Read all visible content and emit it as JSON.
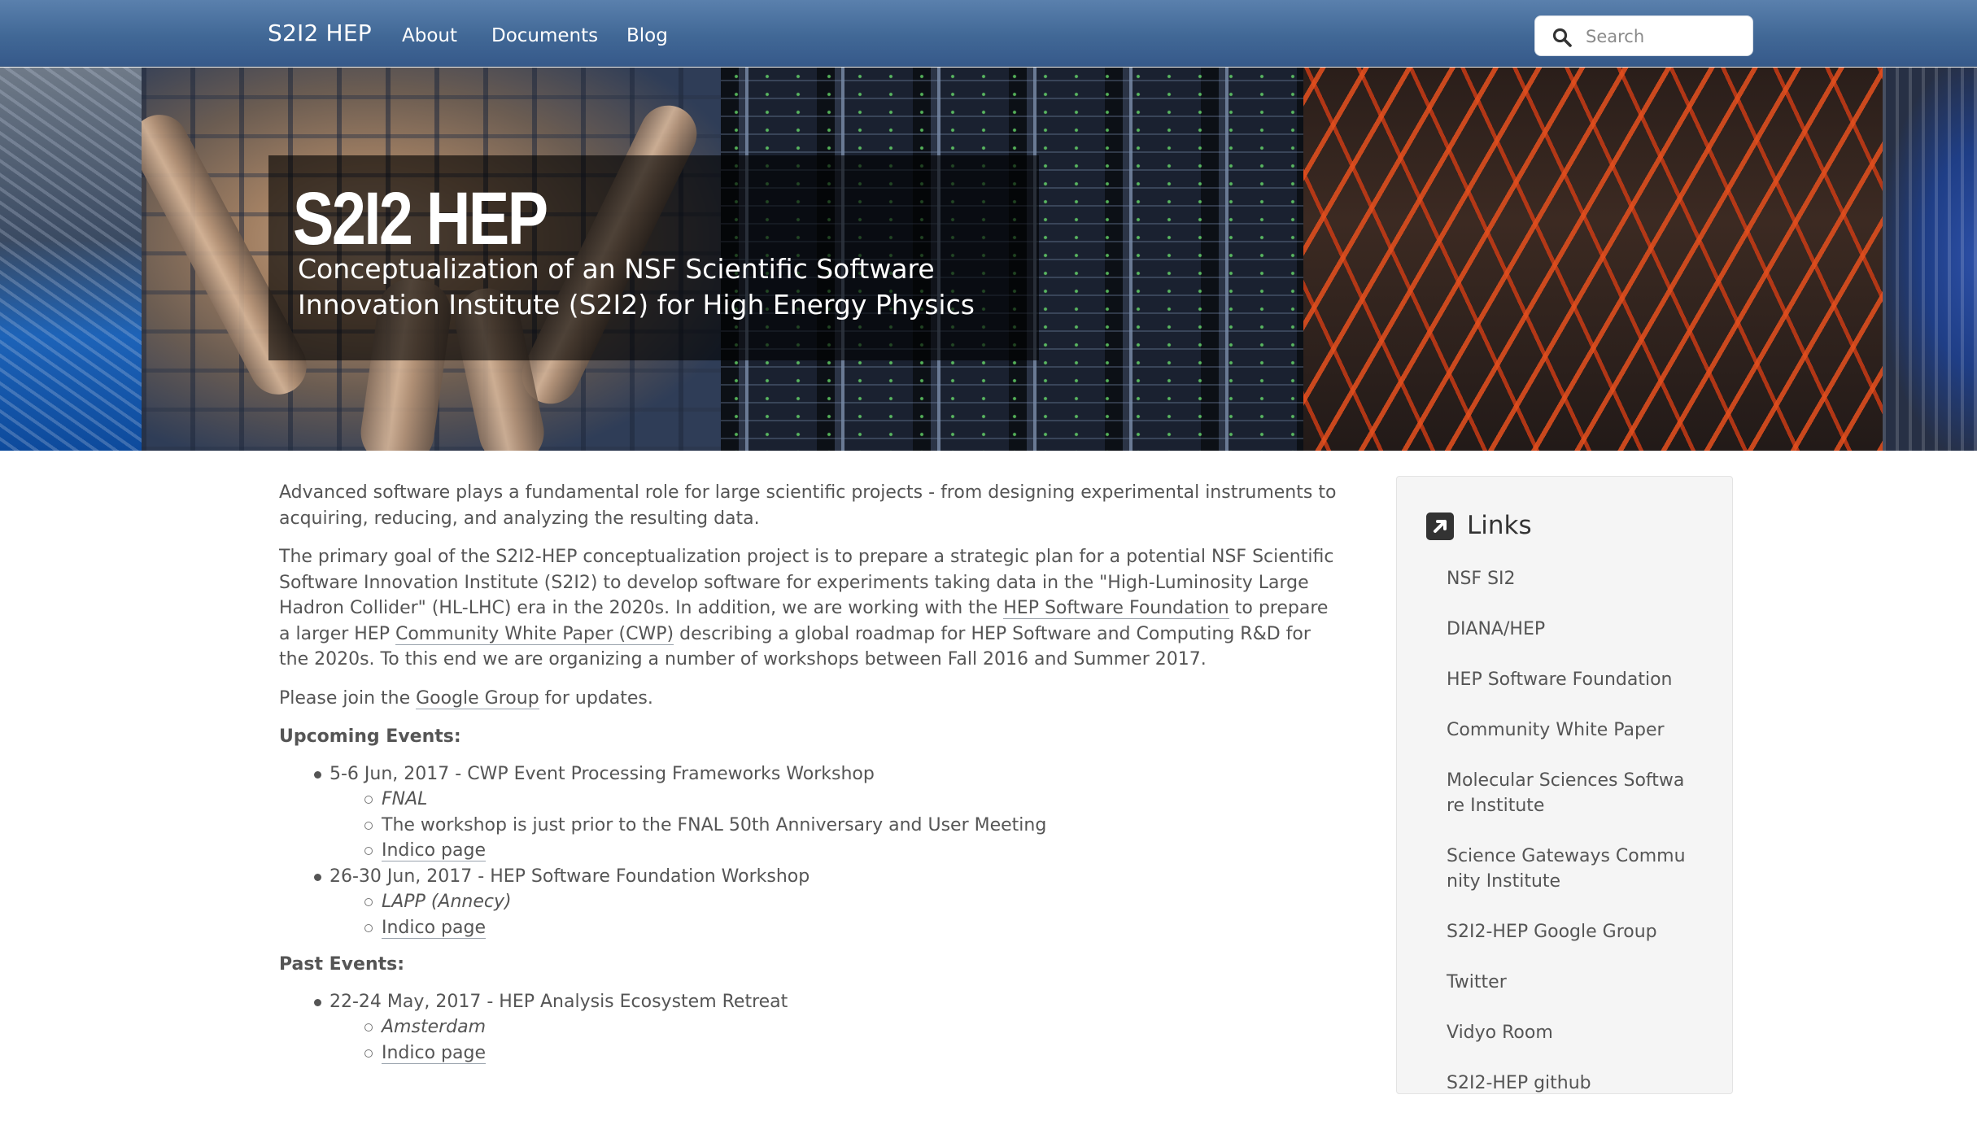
{
  "navbar": {
    "brand": "S2I2 HEP",
    "links": [
      "About",
      "Documents",
      "Blog"
    ],
    "search_placeholder": "Search"
  },
  "hero": {
    "title": "S2I2 HEP",
    "subtitle": "Conceptualization of an NSF Scientific Software Innovation Institute (S2I2) for High Energy Physics"
  },
  "main": {
    "intro": "Advanced software plays a fundamental role for large scientific projects - from designing experimental instruments to acquiring, reducing, and analyzing the resulting data.",
    "goal": {
      "part1": "The primary goal of the S2I2-HEP conceptualization project is to prepare a strategic plan for a potential NSF Scientific Software Innovation Institute (S2I2) to develop software for experiments taking data in the \"High-Luminosity Large Hadron Collider\" (HL-LHC) era in the 2020s. In addition, we are working with the ",
      "link_hsf": "HEP Software Foundation",
      "part2": " to prepare a larger HEP ",
      "link_cwp": "Community White Paper (CWP)",
      "part3": " describing a global roadmap for HEP Software and Computing R&D for the 2020s. To this end we are organizing a number of workshops between Fall 2016 and Summer 2017."
    },
    "join": {
      "before": "Please join the ",
      "link": "Google Group",
      "after": " for updates."
    },
    "upcoming_heading": "Upcoming Events:",
    "upcoming": [
      {
        "title": "5-6 Jun, 2017 - CWP Event Processing Frameworks Workshop",
        "location": "FNAL",
        "note": "The workshop is just prior to the FNAL 50th Anniversary and User Meeting",
        "link": "Indico page"
      },
      {
        "title": "26-30 Jun, 2017 - HEP Software Foundation Workshop",
        "location": "LAPP (Annecy)",
        "link": "Indico page"
      }
    ],
    "past_heading": "Past Events:",
    "past": [
      {
        "title": "22-24 May, 2017 - HEP Analysis Ecosystem Retreat",
        "location": "Amsterdam",
        "link": "Indico page"
      }
    ]
  },
  "sidebar": {
    "title": "Links",
    "links": [
      "NSF SI2",
      "DIANA/HEP",
      "HEP Software Foundation",
      "Community White Paper",
      "Molecular Sciences Software Institute",
      "Science Gateways Community Institute",
      "S2I2-HEP Google Group",
      "Twitter",
      "Vidyo Room",
      "S2I2-HEP github"
    ]
  },
  "colors": {
    "navbar": "#416896",
    "text": "#555555",
    "sidebar_bg": "#f5f5f5"
  }
}
